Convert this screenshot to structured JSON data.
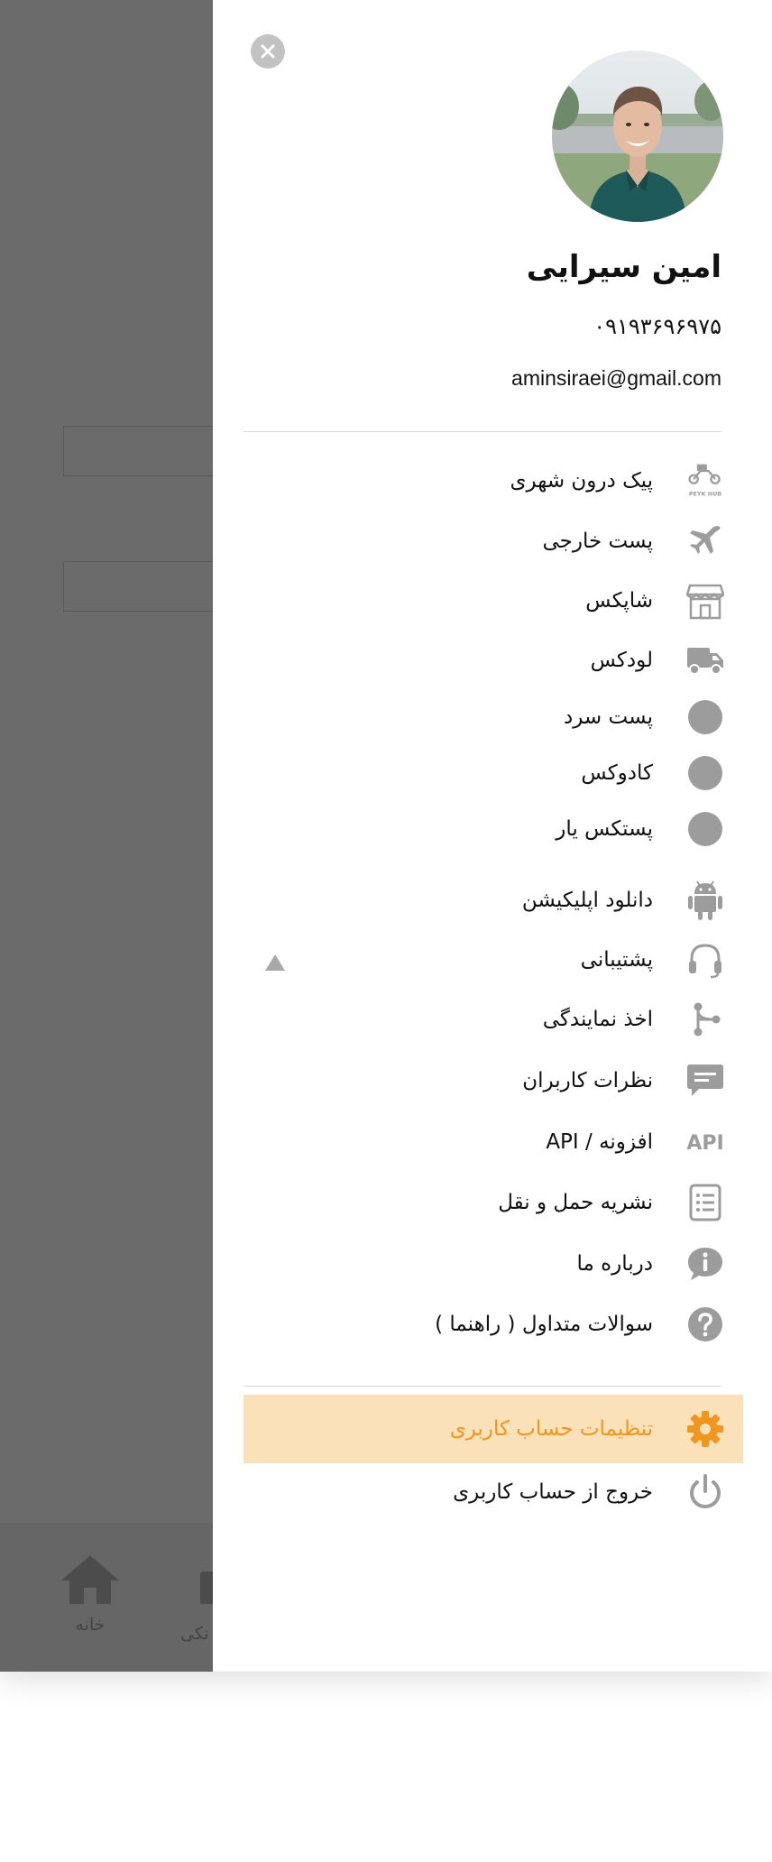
{
  "user": {
    "name": "امین سیرایی",
    "phone": "۰۹۱۹۳۶۹۶۹۷۵",
    "email": "aminsiraei@gmail.com"
  },
  "menu": [
    {
      "label": "پیک درون شهری",
      "icon": "peyk-hub-icon"
    },
    {
      "label": "پست خارجی",
      "icon": "airplane-icon"
    },
    {
      "label": "شاپکس",
      "icon": "store-icon"
    },
    {
      "label": "لودکس",
      "icon": "truck-icon"
    },
    {
      "label": "پست سرد",
      "icon": "circle-placeholder-icon"
    },
    {
      "label": "کادوکس",
      "icon": "circle-placeholder-icon"
    },
    {
      "label": "پستکس یار",
      "icon": "circle-placeholder-icon"
    },
    {
      "label": "دانلود اپلیکیشن",
      "icon": "android-icon"
    },
    {
      "label": "پشتیبانی",
      "icon": "headset-icon"
    },
    {
      "label": "اخذ نمایندگی",
      "icon": "branch-icon"
    },
    {
      "label": "نظرات کاربران",
      "icon": "comment-icon"
    },
    {
      "label": "افزونه / API",
      "icon": "api-icon"
    },
    {
      "label": "نشریه حمل و نقل",
      "icon": "list-document-icon"
    },
    {
      "label": "درباره ما",
      "icon": "info-icon"
    },
    {
      "label": "سوالات متداول ( راهنما )",
      "icon": "question-icon"
    }
  ],
  "account": {
    "settings_label": "تنظیمات حساب کاربری",
    "logout_label": "خروج از حساب کاربری"
  },
  "logo_text": "PEYK HUB",
  "api_icon_text": "API",
  "bottom_nav": {
    "home_label": "خانه",
    "partial_label": "نکی"
  },
  "colors": {
    "accent": "#f0951e",
    "active_bg": "#fae1b9",
    "icon_gray": "#9c9c9c",
    "overlay": "#6b6b6b"
  }
}
